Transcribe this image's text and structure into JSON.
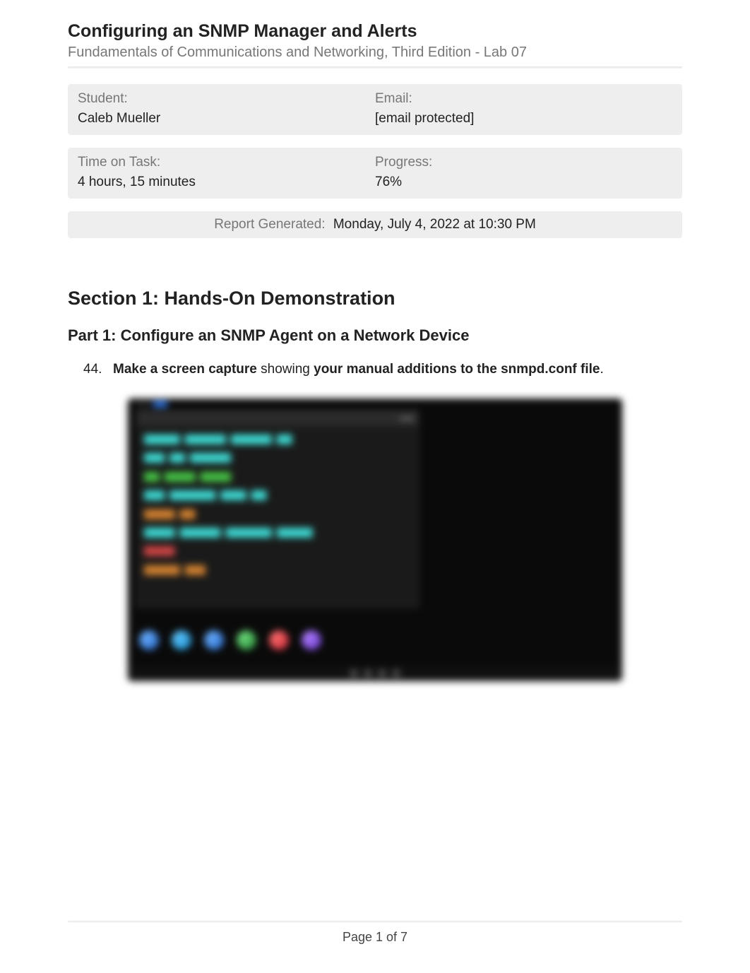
{
  "header": {
    "title": "Configuring an SNMP Manager and Alerts",
    "subtitle": "Fundamentals of Communications and Networking, Third Edition - Lab 07"
  },
  "info": {
    "student_label": "Student:",
    "student_value": "Caleb Mueller",
    "email_label": "Email:",
    "email_value": "[email protected]",
    "time_label": "Time on Task:",
    "time_value": "4 hours, 15 minutes",
    "progress_label": "Progress:",
    "progress_value": "76%"
  },
  "report": {
    "label": "Report Generated:",
    "value": "Monday, July 4, 2022 at 10:30 PM"
  },
  "section": {
    "heading": "Section 1: Hands-On Demonstration",
    "part_heading": "Part 1: Configure an SNMP Agent on a Network Device"
  },
  "step": {
    "number": "44.",
    "bold1": "Make a screen capture",
    "mid": " showing ",
    "bold2": "your manual additions to the snmpd.conf file",
    "tail": "."
  },
  "footer": {
    "page_text": "Page 1 of 7"
  }
}
